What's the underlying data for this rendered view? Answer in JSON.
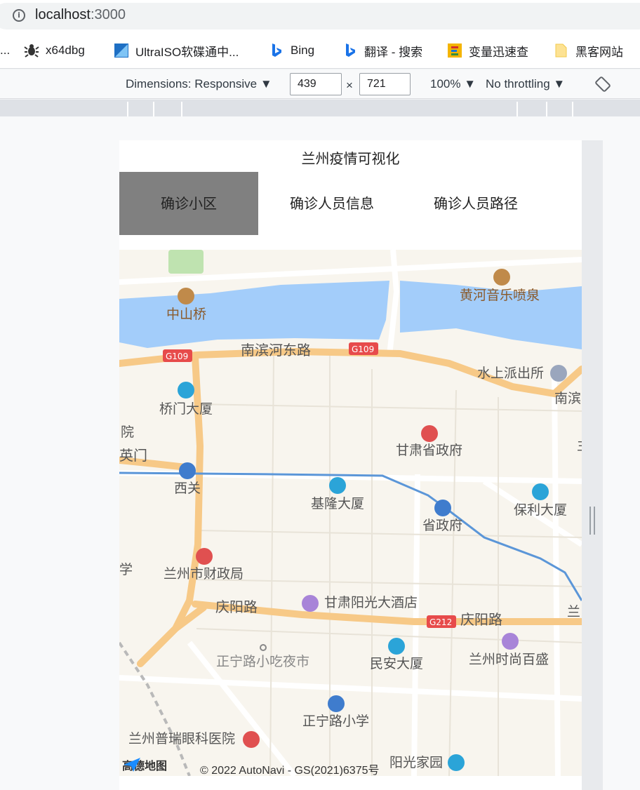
{
  "browser": {
    "url_host": "localhost",
    "url_port": ":3000",
    "bookmarks": [
      {
        "label": "x64dbg",
        "icon": "bug-icon"
      },
      {
        "label": "UltraISO软碟通中...",
        "icon": "ultraiso-icon"
      },
      {
        "label": "Bing",
        "icon": "bing-icon"
      },
      {
        "label": "翻译 - 搜索",
        "icon": "bing-icon"
      },
      {
        "label": "变量迅速查",
        "icon": "codelf-icon"
      },
      {
        "label": "黑客网站",
        "icon": "folder-icon"
      }
    ],
    "bookmark_prefix": "..."
  },
  "devtools": {
    "dimensions_label": "Dimensions: Responsive",
    "width": "439",
    "height": "721",
    "times": "×",
    "zoom": "100%",
    "throttling": "No throttling"
  },
  "app": {
    "title": "兰州疫情可视化",
    "tabs": [
      {
        "label": "确诊小区",
        "active": true
      },
      {
        "label": "确诊人员信息",
        "active": false
      },
      {
        "label": "确诊人员路径",
        "active": false
      }
    ]
  },
  "map": {
    "labels": {
      "zhongshanqiao": "中山桥",
      "huanghe_fountain": "黄河音乐喷泉",
      "nanbin_road": "南滨河东路",
      "g109_a": "G109",
      "g109_b": "G109",
      "police": "水上派出所",
      "nanbin_cut": "南滨",
      "qiaomen": "桥门大厦",
      "yuan": "院",
      "yingmen": "英门",
      "gov": "甘肃省政府",
      "xiguan": "西关",
      "jilong": "基隆大厦",
      "shengzhengfu": "省政府",
      "baoli": "保利大厦",
      "xue": "学",
      "caizheng": "兰州市财政局",
      "qingyang_a": "庆阳路",
      "yangguang_hotel": "甘肃阳光大酒店",
      "g212": "G212",
      "qingyang_b": "庆阳路",
      "lan_cut": "兰",
      "night_market": "正宁路小吃夜市",
      "minan": "民安大厦",
      "shishang": "兰州时尚百盛",
      "zhengning_school": "正宁路小学",
      "hospital": "兰州普瑞眼科医院",
      "yangguang_home": "阳光家园",
      "right_edge": "主"
    },
    "logo_text": "高德地图",
    "copyright": "© 2022 AutoNavi - GS(2021)6375号",
    "colors": {
      "water": "#a3cdfa",
      "road_major": "#f7c987",
      "metro": "#5b96d8",
      "background": "#f8f5ee"
    }
  }
}
